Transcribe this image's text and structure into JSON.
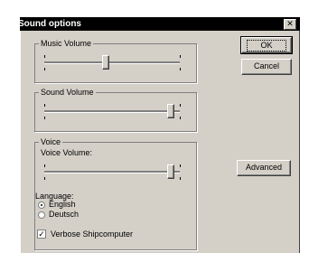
{
  "window": {
    "title": "Sound options",
    "close_glyph": "✕"
  },
  "buttons": {
    "ok": "OK",
    "cancel": "Cancel",
    "advanced": "Advanced"
  },
  "music": {
    "legend": "Music Volume",
    "value": 0.45
  },
  "sound": {
    "legend": "Sound Volume",
    "value": 0.93
  },
  "voice": {
    "legend": "Voice",
    "volume_label": "Voice Volume:",
    "value": 0.93,
    "language_label": "Language:",
    "languages": [
      {
        "label": "English",
        "selected": true
      },
      {
        "label": "Deutsch",
        "selected": false
      }
    ],
    "verbose_label": "Verbose Shipcomputer",
    "verbose_checked": true,
    "check_glyph": "✓"
  }
}
